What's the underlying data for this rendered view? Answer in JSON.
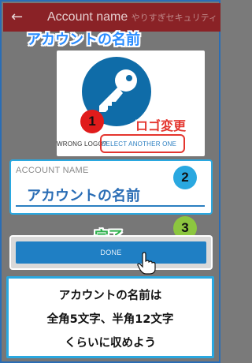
{
  "header": {
    "back_glyph": "←",
    "title": "Account name",
    "watermark": "やりすぎセキュリティ"
  },
  "annotations": {
    "title": "アカウントの名前",
    "logo_change": "ロゴ変更",
    "done_jp": "完了",
    "steps": [
      "1",
      "2",
      "3"
    ],
    "note_lines": [
      "アカウントの名前は",
      "全角5文字、半角12文字",
      "くらいに収めよう"
    ]
  },
  "logo": {
    "icon": "key-icon",
    "wrong_logo_text": "WRONG LOGO?",
    "select_another_text": "SELECT ANOTHER ONE"
  },
  "account_field": {
    "label": "ACCOUNT NAME",
    "value": "アカウントの名前"
  },
  "done_button": {
    "label": "DONE"
  },
  "colors": {
    "topbar": "#8a2226",
    "accent_blue": "#1f7fc4",
    "badge_red": "#e01b1b",
    "badge_blue": "#2aa8e0",
    "badge_green": "#8cc63f"
  }
}
